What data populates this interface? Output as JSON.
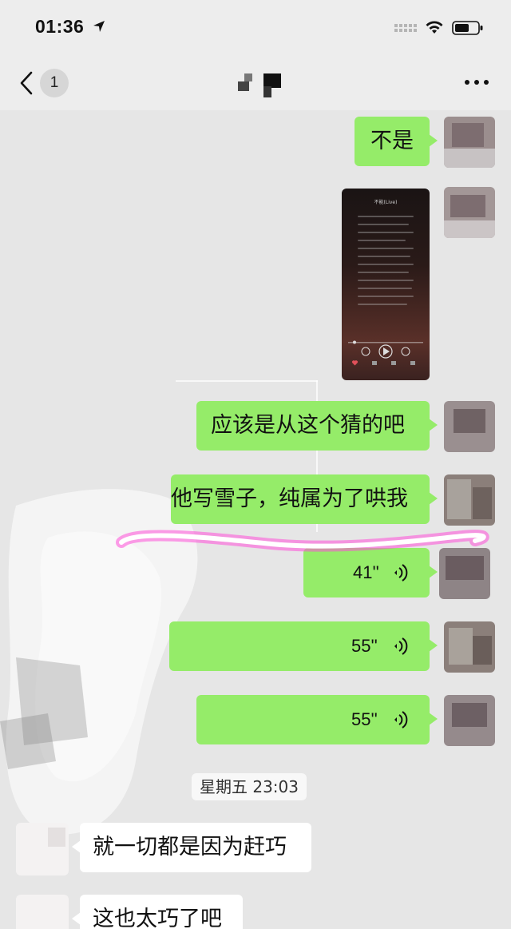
{
  "status_bar": {
    "time": "01:36"
  },
  "nav": {
    "unread_count": "1"
  },
  "messages": {
    "m1": "不是",
    "m3": "应该是从这个猜的吧",
    "m4": "他写雪子，纯属为了哄我",
    "v1": "41''",
    "v2": "55''",
    "v3": "55''",
    "timestamp": "星期五 23:03",
    "in1": "就一切都是因为赶巧",
    "in2": "这也太巧了吧"
  },
  "shared_screenshot": {
    "title": "不能(Live)"
  },
  "colors": {
    "outgoing_bubble": "#95ec69",
    "incoming_bubble": "#ffffff",
    "highlight_stroke": "#ff4fd8"
  }
}
